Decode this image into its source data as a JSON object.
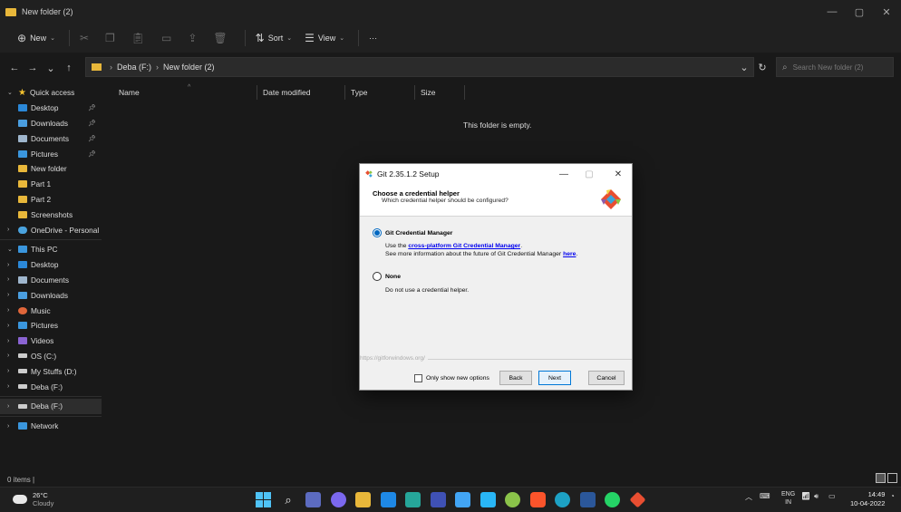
{
  "window": {
    "title": "New folder (2)",
    "minimize": "—",
    "maximize": "▢",
    "close": "✕"
  },
  "toolbar": {
    "new_label": "New",
    "sort_label": "Sort",
    "view_label": "View",
    "more_label": "···"
  },
  "address": {
    "breadcrumb": [
      "Deba (F:)",
      "New folder (2)"
    ],
    "search_placeholder": "Search New folder (2)"
  },
  "sidebar": {
    "quick_access": "Quick access",
    "quick_items": [
      {
        "label": "Desktop",
        "icon": "desktop-icon",
        "color": "#2b88d8",
        "pinned": true
      },
      {
        "label": "Downloads",
        "icon": "download-icon",
        "color": "#4a9ee0",
        "pinned": true
      },
      {
        "label": "Documents",
        "icon": "document-icon",
        "color": "#9fb6cd",
        "pinned": true
      },
      {
        "label": "Pictures",
        "icon": "pictures-icon",
        "color": "#3a96dd",
        "pinned": true
      },
      {
        "label": "New folder",
        "icon": "folder-icon",
        "color": "#e8b73a",
        "pinned": false
      },
      {
        "label": "Part 1",
        "icon": "folder-icon",
        "color": "#e8b73a",
        "pinned": false
      },
      {
        "label": "Part 2",
        "icon": "folder-icon",
        "color": "#e8b73a",
        "pinned": false
      },
      {
        "label": "Screenshots",
        "icon": "folder-icon",
        "color": "#e8b73a",
        "pinned": false
      }
    ],
    "onedrive": "OneDrive - Personal",
    "this_pc": "This PC",
    "pc_items": [
      {
        "label": "Desktop",
        "icon": "desktop-icon",
        "color": "#2b88d8"
      },
      {
        "label": "Documents",
        "icon": "document-icon",
        "color": "#9fb6cd"
      },
      {
        "label": "Downloads",
        "icon": "download-icon",
        "color": "#4a9ee0"
      },
      {
        "label": "Music",
        "icon": "music-icon",
        "color": "#e0663a"
      },
      {
        "label": "Pictures",
        "icon": "pictures-icon",
        "color": "#3a96dd"
      },
      {
        "label": "Videos",
        "icon": "videos-icon",
        "color": "#8a63d2"
      },
      {
        "label": "OS (C:)",
        "icon": "drive-icon",
        "color": "#cccccc"
      },
      {
        "label": "My Stuffs (D:)",
        "icon": "drive-icon",
        "color": "#cccccc"
      },
      {
        "label": "Deba (F:)",
        "icon": "drive-icon",
        "color": "#cccccc"
      }
    ],
    "deba": "Deba (F:)",
    "network": "Network"
  },
  "columns": [
    "Name",
    "Date modified",
    "Type",
    "Size"
  ],
  "empty_message": "This folder is empty.",
  "status": "0 items  |",
  "dialog": {
    "title": "Git 2.35.1.2 Setup",
    "heading": "Choose a credential helper",
    "subheading": "Which credential helper should be configured?",
    "option1": {
      "label": "Git Credential Manager",
      "line1_prefix": "Use the ",
      "line1_link": "cross-platform Git Credential Manager",
      "line1_suffix": ".",
      "line2_prefix": "See more information about the future of Git Credential Manager ",
      "line2_link": "here",
      "line2_suffix": ".",
      "selected": true
    },
    "option2": {
      "label": "None",
      "desc": "Do not use a credential helper.",
      "selected": false
    },
    "footer_link": "https://gitforwindows.org/",
    "checkbox_label": "Only show new options",
    "back": "Back",
    "next": "Next",
    "cancel": "Cancel"
  },
  "taskbar": {
    "temperature": "26°C",
    "weather": "Cloudy",
    "lang1": "ENG",
    "lang2": "IN",
    "time": "14:49",
    "date": "10-04-2022"
  }
}
